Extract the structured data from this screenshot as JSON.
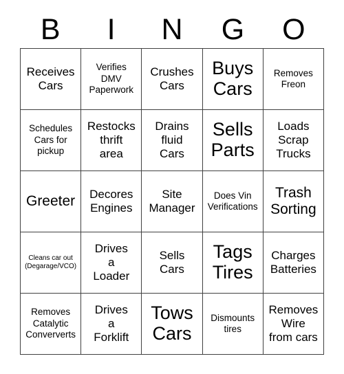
{
  "header": {
    "letters": [
      "B",
      "I",
      "N",
      "G",
      "O"
    ]
  },
  "grid": {
    "columns": 5,
    "rows": 5,
    "cells": [
      {
        "text": "Receives\nCars",
        "size": "md"
      },
      {
        "text": "Verifies\nDMV\nPaperwork",
        "size": "sm"
      },
      {
        "text": "Crushes\nCars",
        "size": "md"
      },
      {
        "text": "Buys\nCars",
        "size": "xl"
      },
      {
        "text": "Removes\nFreon",
        "size": "sm"
      },
      {
        "text": "Schedules\nCars for\npickup",
        "size": "sm"
      },
      {
        "text": "Restocks\nthrift\narea",
        "size": "md"
      },
      {
        "text": "Drains\nfluid\nCars",
        "size": "md"
      },
      {
        "text": "Sells\nParts",
        "size": "xl"
      },
      {
        "text": "Loads\nScrap\nTrucks",
        "size": "md"
      },
      {
        "text": "Greeter",
        "size": "lg"
      },
      {
        "text": "Decores\nEngines",
        "size": "md"
      },
      {
        "text": "Site\nManager",
        "size": "md"
      },
      {
        "text": "Does Vin\nVerifications",
        "size": "sm"
      },
      {
        "text": "Trash\nSorting",
        "size": "lg"
      },
      {
        "text": "Cleans car out\n(Degarage/VCO)",
        "size": "xs"
      },
      {
        "text": "Drives\na\nLoader",
        "size": "md"
      },
      {
        "text": "Sells\nCars",
        "size": "md"
      },
      {
        "text": "Tags\nTires",
        "size": "xl"
      },
      {
        "text": "Charges\nBatteries",
        "size": "md"
      },
      {
        "text": "Removes\nCatalytic\nConververts",
        "size": "sm"
      },
      {
        "text": "Drives\na\nForklift",
        "size": "md"
      },
      {
        "text": "Tows\nCars",
        "size": "xl"
      },
      {
        "text": "Dismounts\ntires",
        "size": "sm"
      },
      {
        "text": "Removes\nWire\nfrom cars",
        "size": "md"
      }
    ]
  },
  "colors": {
    "background": "#ffffff",
    "text": "#000000",
    "grid_line": "#404040"
  }
}
